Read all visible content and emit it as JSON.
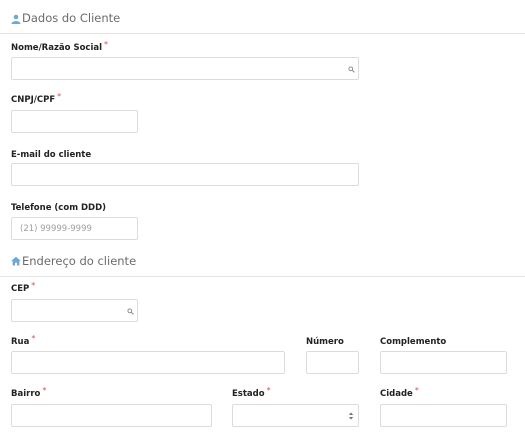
{
  "client_section": {
    "title": "Dados do Cliente",
    "icon": "user-icon",
    "fields": {
      "name": {
        "label": "Nome/Razão Social",
        "required_mark": "*",
        "value": ""
      },
      "cnpj": {
        "label": "CNPJ/CPF",
        "required_mark": "*",
        "value": ""
      },
      "email": {
        "label": "E-mail do cliente",
        "value": ""
      },
      "phone": {
        "label": "Telefone (com DDD)",
        "placeholder": "(21) 99999-9999",
        "value": ""
      }
    }
  },
  "address_section": {
    "title": "Endereço do cliente",
    "icon": "home-icon",
    "fields": {
      "cep": {
        "label": "CEP",
        "required_mark": "*",
        "value": ""
      },
      "street": {
        "label": "Rua",
        "required_mark": "*",
        "value": ""
      },
      "number": {
        "label": "Número",
        "value": ""
      },
      "complement": {
        "label": "Complemento",
        "value": ""
      },
      "neighborhood": {
        "label": "Bairro",
        "required_mark": "*",
        "value": ""
      },
      "state": {
        "label": "Estado",
        "required_mark": "*",
        "selected": ""
      },
      "city": {
        "label": "Cidade",
        "required_mark": "*",
        "value": ""
      }
    }
  },
  "colors": {
    "required": "#e0494a",
    "icon": "#6ea8d6",
    "border": "#dcdcdc"
  }
}
